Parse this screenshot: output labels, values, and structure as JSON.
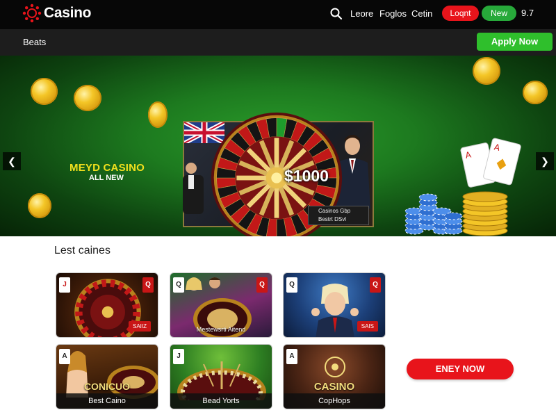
{
  "header": {
    "brand": "Casino",
    "nav": [
      "Leore",
      "Foglos",
      "Cetin"
    ],
    "login_label": "Loqnt",
    "new_label": "New",
    "balance": "9.7"
  },
  "subbar": {
    "label": "Beats",
    "apply_label": "Apply Now"
  },
  "hero": {
    "title": "MEYD CASINO",
    "subtitle": "ALL NEW",
    "prize": "$1000",
    "plaque_line1": "Casinos Gbp",
    "plaque_line2": "Bestrt DSvl",
    "prev_icon": "chevron-left-icon",
    "next_icon": "chevron-right-icon"
  },
  "section": {
    "title": "Lest caines"
  },
  "tiles": [
    {
      "card": "J",
      "card_side": "Q",
      "badge": "SAIIZ",
      "caption": ""
    },
    {
      "card": "Q",
      "card_side": "Q",
      "badge": "",
      "caption": "Mestewsrti Aitend"
    },
    {
      "card": "Q",
      "card_side": "Q",
      "badge": "SAIS",
      "caption": ""
    },
    {
      "card": "A",
      "card_side": "",
      "badge": "",
      "caption": "Best Caino",
      "brand": "CONICUO"
    },
    {
      "card": "J",
      "card_side": "",
      "badge": "",
      "caption": "Bead Yorts"
    },
    {
      "card": "A",
      "card_side": "",
      "badge": "",
      "caption": "CopHops",
      "brand": "CASINO"
    }
  ],
  "cta": {
    "label": "ENEY NOW"
  },
  "colors": {
    "nav_bg": "#070707",
    "accent_red": "#e8141b",
    "accent_green": "#2fbf2c",
    "felt_green": "#1d7a1f",
    "gold": "#f4c627"
  }
}
